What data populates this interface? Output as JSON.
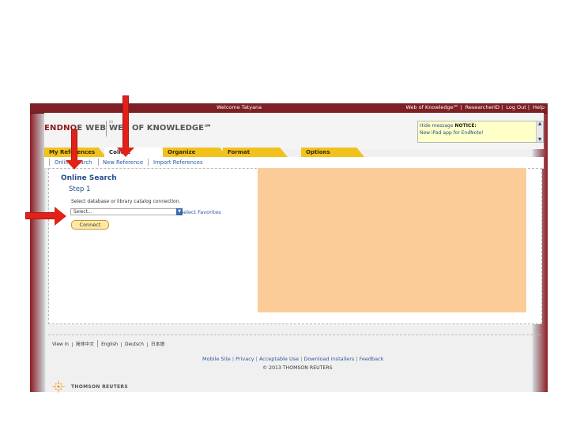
{
  "topbar": {
    "welcome": "Welcome Tatyana",
    "links": [
      "Web of Knowledge℠",
      "ResearcherID",
      "Log Out",
      "Help"
    ]
  },
  "header": {
    "endnote_logo_a": "ENDNO",
    "endnote_logo_b": "E WEB",
    "wok_logo_small": "ISI",
    "wok_logo": "WEB OF KNOWLEDGE℠",
    "notice": {
      "hide_link": "Hide message",
      "notice_label": "NOTICE:",
      "message": "New iPad app for EndNote!"
    }
  },
  "tabs": [
    "My References",
    "Collect",
    "Organize",
    "Format",
    "Options"
  ],
  "active_tab": "Collect",
  "subtabs": [
    "Online Search",
    "New Reference",
    "Import References"
  ],
  "content": {
    "title": "Online Search",
    "step": "Step 1",
    "instruction": "Select database or library catalog connection.",
    "select_value": "Select...",
    "favorites_link": "Select Favorites",
    "connect_button": "Connect"
  },
  "footer": {
    "languages": [
      "View in",
      "简体中文",
      "English",
      "Deutsch",
      "日本語"
    ],
    "links": [
      "Mobile Site",
      "Privacy",
      "Acceptable Use",
      "Download Installers",
      "Feedback"
    ],
    "copyright": "© 2013 THOMSON REUTERS",
    "company": "THOMSON REUTERS"
  },
  "colors": {
    "brand_red": "#7d1f24",
    "tab_yellow": "#f2c21c",
    "overlay_orange": "#fccc98",
    "annotation_arrow": "#e32119",
    "link_blue": "#2a5aa0"
  },
  "icons": [
    "chevron-up-icon",
    "chevron-down-icon",
    "dropdown-arrow-icon",
    "thomson-reuters-logo-icon",
    "red-annotation-arrow"
  ]
}
